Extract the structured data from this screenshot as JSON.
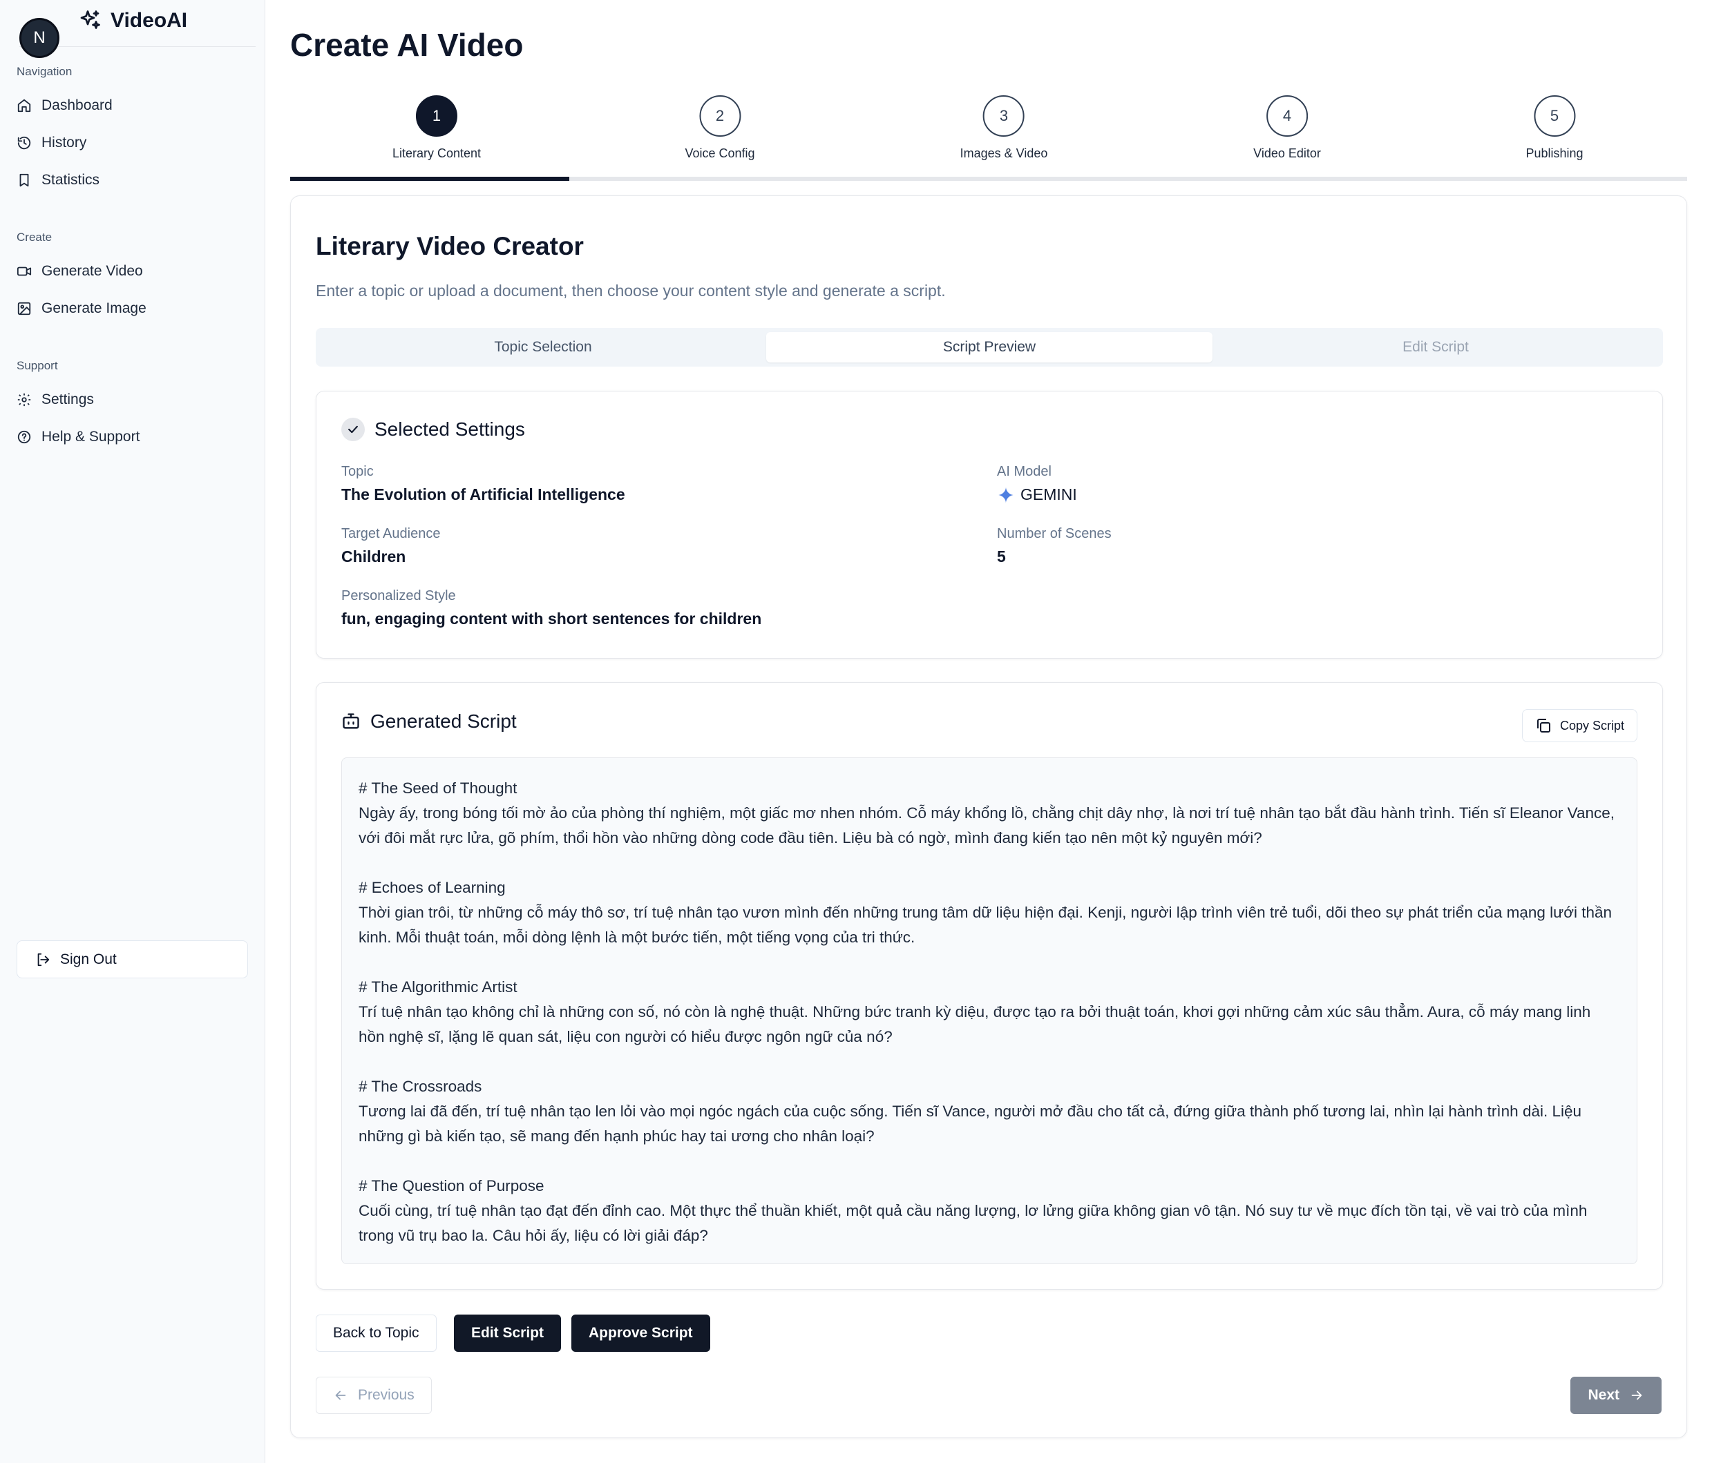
{
  "app": {
    "avatar_initial": "N",
    "brand": "VideoAI"
  },
  "sidebar": {
    "sections": [
      {
        "title": "Navigation",
        "items": [
          {
            "label": "Dashboard",
            "icon": "home-icon"
          },
          {
            "label": "History",
            "icon": "history-icon"
          },
          {
            "label": "Statistics",
            "icon": "bookmark-icon"
          }
        ]
      },
      {
        "title": "Create",
        "items": [
          {
            "label": "Generate Video",
            "icon": "video-icon"
          },
          {
            "label": "Generate Image",
            "icon": "image-icon"
          }
        ]
      },
      {
        "title": "Support",
        "items": [
          {
            "label": "Settings",
            "icon": "gear-icon"
          },
          {
            "label": "Help & Support",
            "icon": "help-icon"
          }
        ]
      }
    ],
    "sign_out": "Sign Out"
  },
  "page": {
    "title": "Create AI Video"
  },
  "stepper": {
    "steps": [
      {
        "number": "1",
        "label": "Literary Content",
        "active": true
      },
      {
        "number": "2",
        "label": "Voice Config",
        "active": false
      },
      {
        "number": "3",
        "label": "Images & Video",
        "active": false
      },
      {
        "number": "4",
        "label": "Video Editor",
        "active": false
      },
      {
        "number": "5",
        "label": "Publishing",
        "active": false
      }
    ],
    "progress_fraction": 0.2
  },
  "creator": {
    "title": "Literary Video Creator",
    "subtitle": "Enter a topic or upload a document, then choose your content style and generate a script.",
    "tabs": [
      {
        "label": "Topic Selection",
        "state": "normal"
      },
      {
        "label": "Script Preview",
        "state": "active"
      },
      {
        "label": "Edit Script",
        "state": "disabled"
      }
    ]
  },
  "settings": {
    "title": "Selected Settings",
    "topic_label": "Topic",
    "topic_value": "The Evolution of Artificial Intelligence",
    "model_label": "AI Model",
    "model_value": "GEMINI",
    "audience_label": "Target Audience",
    "audience_value": "Children",
    "scenes_label": "Number of Scenes",
    "scenes_value": "5",
    "style_label": "Personalized Style",
    "style_value": "fun, engaging content with short sentences for children"
  },
  "script": {
    "title": "Generated Script",
    "copy_label": "Copy Script",
    "scenes": [
      {
        "heading": "# The Seed of Thought",
        "text": "Ngày ấy, trong bóng tối mờ ảo của phòng thí nghiệm, một giấc mơ nhen nhóm. Cỗ máy khổng lồ, chằng chịt dây nhợ, là nơi trí tuệ nhân tạo bắt đầu hành trình. Tiến sĩ Eleanor Vance, với đôi mắt rực lửa, gõ phím, thổi hồn vào những dòng code đầu tiên. Liệu bà có ngờ, mình đang kiến tạo nên một kỷ nguyên mới?"
      },
      {
        "heading": "# Echoes of Learning",
        "text": "Thời gian trôi, từ những cỗ máy thô sơ, trí tuệ nhân tạo vươn mình đến những trung tâm dữ liệu hiện đại. Kenji, người lập trình viên trẻ tuổi, dõi theo sự phát triển của mạng lưới thần kinh. Mỗi thuật toán, mỗi dòng lệnh là một bước tiến, một tiếng vọng của tri thức."
      },
      {
        "heading": "# The Algorithmic Artist",
        "text": "Trí tuệ nhân tạo không chỉ là những con số, nó còn là nghệ thuật. Những bức tranh kỳ diệu, được tạo ra bởi thuật toán, khơi gợi những cảm xúc sâu thẳm. Aura, cỗ máy mang linh hồn nghệ sĩ, lặng lẽ quan sát, liệu con người có hiểu được ngôn ngữ của nó?"
      },
      {
        "heading": "# The Crossroads",
        "text": "Tương lai đã đến, trí tuệ nhân tạo len lỏi vào mọi ngóc ngách của cuộc sống. Tiến sĩ Vance, người mở đầu cho tất cả, đứng giữa thành phố tương lai, nhìn lại hành trình dài. Liệu những gì bà kiến tạo, sẽ mang đến hạnh phúc hay tai ương cho nhân loại?"
      },
      {
        "heading": "# The Question of Purpose",
        "text": "Cuối cùng, trí tuệ nhân tạo đạt đến đỉnh cao. Một thực thể thuần khiết, một quả cầu năng lượng, lơ lửng giữa không gian vô tận. Nó suy tư về mục đích tồn tại, về vai trò của mình trong vũ trụ bao la. Câu hỏi ấy, liệu có lời giải đáp?"
      }
    ]
  },
  "actions": {
    "back": "Back to Topic",
    "edit": "Edit Script",
    "approve": "Approve Script",
    "previous": "Previous",
    "next": "Next"
  },
  "colors": {
    "primary": "#0f172a",
    "muted": "#64748b",
    "gemini_star": "#4f7fe0",
    "next_disabled": "#7c8593"
  }
}
